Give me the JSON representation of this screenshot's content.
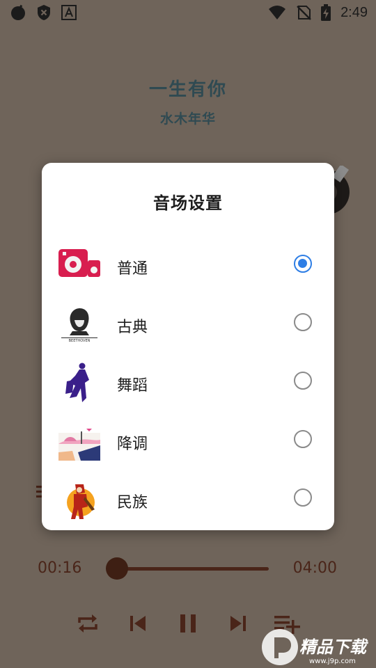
{
  "status_bar": {
    "time": "2:49",
    "left_icons": [
      "app-circle-icon",
      "shield-x-icon",
      "font-a-icon"
    ],
    "right_icons": [
      "wifi-icon",
      "no-sim-icon",
      "battery-charging-icon"
    ]
  },
  "player": {
    "title": "一生有你",
    "artist": "水木年华",
    "current_time": "00:16",
    "total_time": "04:00",
    "progress": 0.067
  },
  "dialog": {
    "title": "音场设置",
    "options": [
      {
        "label": "普通",
        "selected": true
      },
      {
        "label": "古典",
        "selected": false
      },
      {
        "label": "舞蹈",
        "selected": false
      },
      {
        "label": "降调",
        "selected": false
      },
      {
        "label": "民族",
        "selected": false
      }
    ]
  },
  "watermark": {
    "brand": "精品下载",
    "url": "www.j9p.com"
  },
  "colors": {
    "accent": "#2e7ee5",
    "background": "#6f645a",
    "controls": "#4a2519",
    "title": "#2f4a52"
  }
}
